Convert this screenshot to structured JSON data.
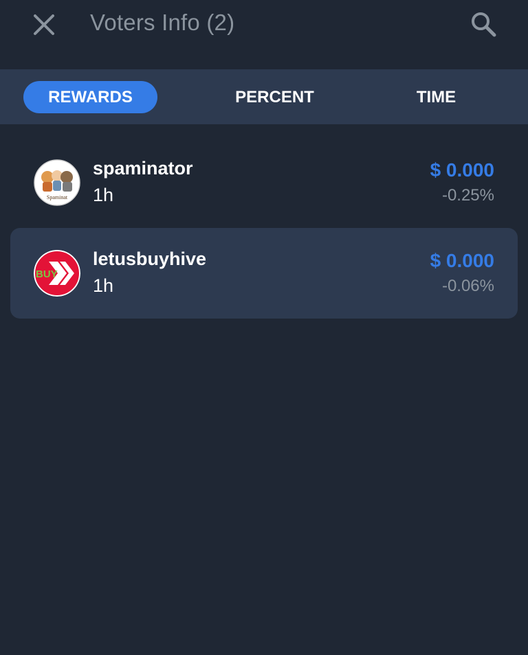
{
  "header": {
    "title": "Voters Info (2)",
    "close_icon": "close-icon",
    "search_icon": "search-icon"
  },
  "tabs": [
    {
      "label": "REWARDS",
      "active": true
    },
    {
      "label": "PERCENT",
      "active": false
    },
    {
      "label": "TIME",
      "active": false
    }
  ],
  "voters": [
    {
      "name": "spaminator",
      "time": "1h",
      "reward": "$ 0.000",
      "percent": "-0.25%",
      "avatar_icon": "cartoon-avatar",
      "avatar_text": "Spaminat"
    },
    {
      "name": "letusbuyhive",
      "time": "1h",
      "reward": "$ 0.000",
      "percent": "-0.06%",
      "avatar_icon": "hive-logo-avatar",
      "avatar_text": "BUY"
    }
  ],
  "colors": {
    "background": "#1f2734",
    "tabbar": "#2d3a50",
    "accent": "#357ce6",
    "muted": "#8b949e",
    "hive_red": "#e31337"
  }
}
